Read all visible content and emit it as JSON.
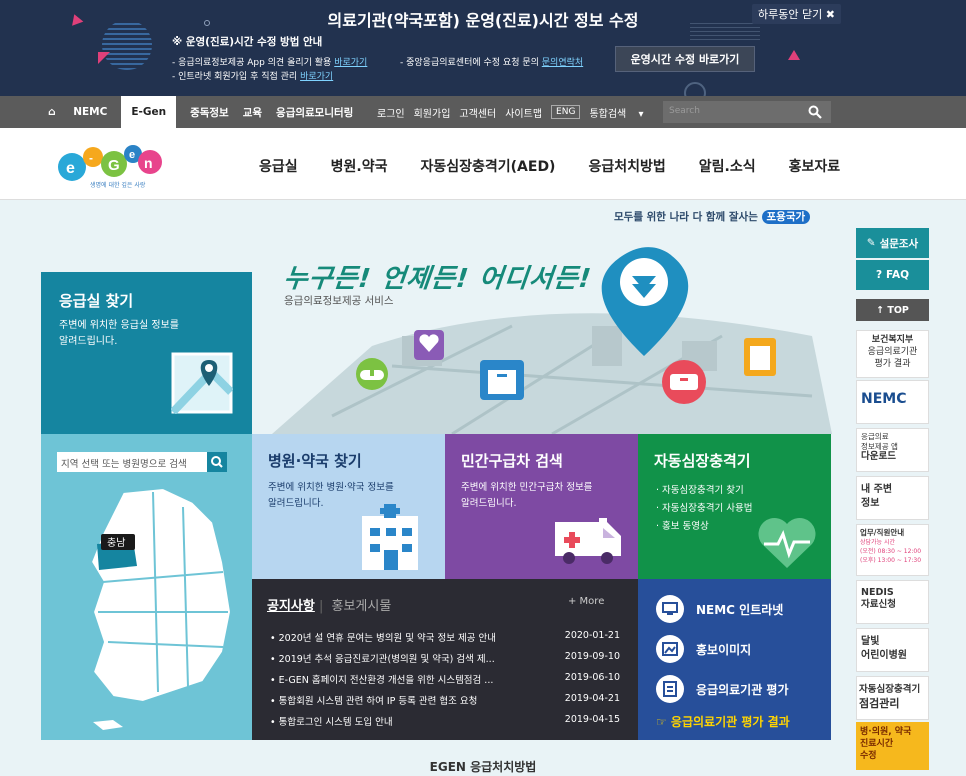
{
  "banner": {
    "title": "의료기관(약국포함) 운영(진료)시간 정보 수정",
    "close_label": "하루동안 닫기",
    "howto_title": "※ 운영(진료)시간 수정 방법 안내",
    "line1_text": "- 응급의료정보제공 App 의견 올리기 활용",
    "line1_link": "바로가기",
    "line2_text": "- 인트라넷 회원가입 후 직접 관리",
    "line2_link": "바로가기",
    "line3_text": "- 중앙응급의료센터에 수정 요청 문의",
    "line3_link": "문의연락처",
    "action_button": "운영시간 수정 바로가기"
  },
  "gnb": {
    "left": [
      "NEMC",
      "E-Gen",
      "중독정보",
      "교육",
      "응급의료모니터링"
    ],
    "right": [
      "로그인",
      "회원가입",
      "고객센터",
      "사이트맵"
    ],
    "eng": "ENG",
    "search_select": "통합검색",
    "search_placeholder": "Search"
  },
  "logo": {
    "tagline": "생명에 대한 깊은 사랑"
  },
  "menu": [
    "응급실",
    "병원.약국",
    "자동심장충격기(AED)",
    "응급처치방법",
    "알림.소식",
    "홍보자료"
  ],
  "slogan": {
    "text": "모두를 위한 나라 다 함께 잘사는",
    "pill": "포용국가"
  },
  "hero": {
    "title": "누구든! 언제든! 어디서든!",
    "subtitle": "응급의료정보제공 서비스"
  },
  "er": {
    "title": "응급실 찾기",
    "desc1": "주변에 위치한 응급실 정보를",
    "desc2": "알려드립니다."
  },
  "map": {
    "search_placeholder": "지역 선택 또는 병원명으로 검색",
    "region_label": "충남"
  },
  "hosp": {
    "title": "병원·약국 찾기",
    "desc1": "주변에 위치한 병원·약국 정보를",
    "desc2": "알려드립니다."
  },
  "amb": {
    "title": "민간구급차 검색",
    "desc1": "주변에 위치한 민간구급차 정보를",
    "desc2": "알려드립니다."
  },
  "aed": {
    "title": "자동심장충격기",
    "items": [
      "· 자동심장충격기 찾기",
      "· 자동심장충격기 사용법",
      "· 홍보 동영상"
    ]
  },
  "notice": {
    "tab_active": "공지사항",
    "tab_inactive": "홍보게시물",
    "more": "+ More",
    "rows": [
      {
        "title": "• 2020년 설 연휴 문여는 병의원 및 약국 정보 제공 안내",
        "date": "2020-01-21"
      },
      {
        "title": "• 2019년 추석 응급진료기관(병의원 및 약국) 검색 제...",
        "date": "2019-09-10"
      },
      {
        "title": "• E-GEN 홈페이지 전산환경 개선을 위한 시스템점검 ...",
        "date": "2019-06-10"
      },
      {
        "title": "• 통합회원 시스템 관련 하여 IP 등록 관련 협조 요청",
        "date": "2019-04-21"
      },
      {
        "title": "• 통합로그인 시스템 도입 안내",
        "date": "2019-04-15"
      }
    ]
  },
  "links": {
    "items": [
      "NEMC 인트라넷",
      "홍보이미지",
      "응급의료기관 평가"
    ],
    "highlight": "☞ 응급의료기관 평가 결과"
  },
  "quick": {
    "survey": "설문조사",
    "faq": "FAQ",
    "top": "↑ TOP",
    "ministry": "보건복지부",
    "ministry_sub1": "응급의료기관",
    "ministry_sub2": "평가 결과",
    "nemc": "NEMC",
    "app1": "응급의료",
    "app2": "정보제공 앱",
    "app3": "다운로드",
    "near1": "내 주변",
    "near2": "정보",
    "biz1": "업무/직원안내",
    "biz2": "상담가능 시간",
    "biz3": "(오전) 08:30 ~ 12:00",
    "biz4": "(오후) 13:00 ~ 17:30",
    "nedis1": "NEDIS",
    "nedis2": "자료신청",
    "moon1": "달빛",
    "moon2": "어린이병원",
    "aedm1": "자동심장충격기",
    "aedm2": "점검관리",
    "edit1": "병·의원, 약국",
    "edit2": "진료시간",
    "edit3": "수정"
  },
  "footer_title": "EGEN 응급처치방법",
  "colors": {
    "banner": "#22324f",
    "gnb": "#5b5b5b",
    "er": "#1585a0",
    "amb": "#7e4aa3",
    "aed": "#119249",
    "links": "#274f9a",
    "notice": "#2b2b33"
  }
}
